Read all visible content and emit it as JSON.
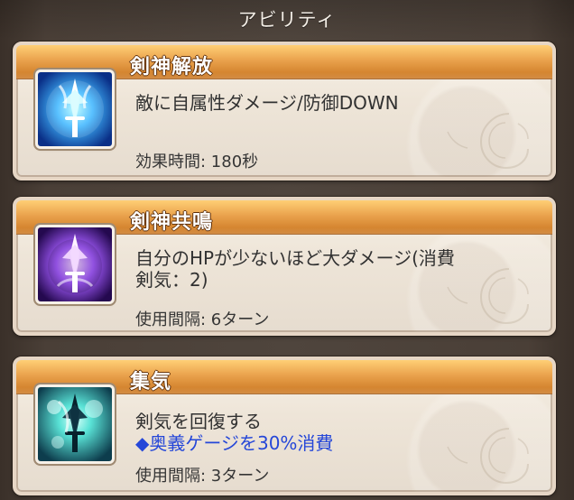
{
  "header": {
    "title": "アビリティ"
  },
  "cards": [
    {
      "title": "剣神解放",
      "description": "敵に自属性ダメージ/防御DOWN",
      "meta": "効果時間: 180秒",
      "icon": "sword-spirit-blue-icon"
    },
    {
      "title": "剣神共鳴",
      "description": "自分のHPが少ないほど大ダメージ(消費\n剣気：2)",
      "meta": "使用間隔: 6ターン",
      "icon": "sword-spirit-purple-icon"
    },
    {
      "title": "集気",
      "description": "剣気を回復する",
      "highlight": "◆奥義ゲージを30%消費",
      "meta": "使用間隔: 3ターン",
      "icon": "sword-spirit-teal-icon"
    }
  ],
  "colors": {
    "background": "#4f453d",
    "card": "#eee5d8",
    "title_bar": "#e9a14c",
    "highlight": "#2547d8"
  }
}
